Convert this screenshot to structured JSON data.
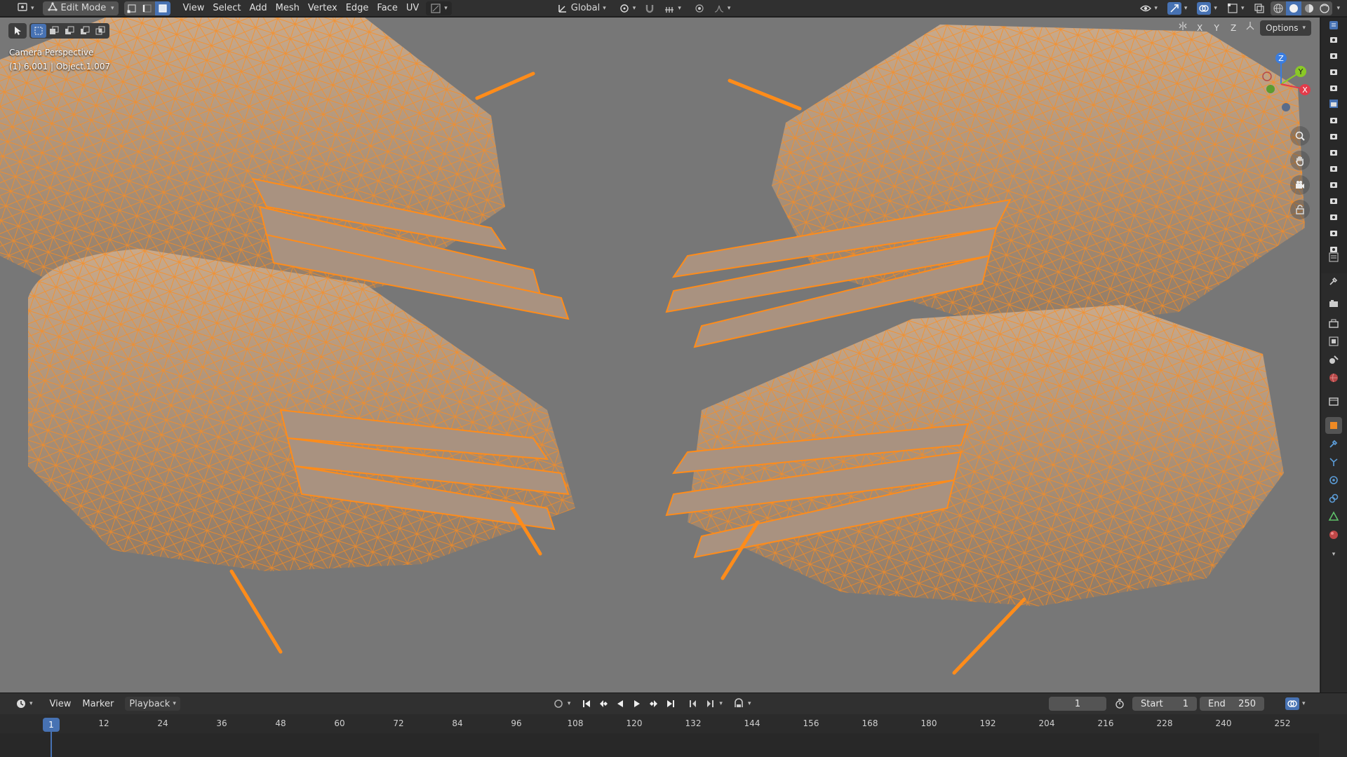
{
  "header": {
    "mode_label": "Edit Mode",
    "menus": [
      "View",
      "Select",
      "Add",
      "Mesh",
      "Vertex",
      "Edge",
      "Face",
      "UV"
    ],
    "orientation_label": "Global",
    "select_modes": [
      "vertex-select",
      "edge-select",
      "face-select"
    ],
    "active_select_mode": "face-select"
  },
  "viewport": {
    "info_line1": "Camera Perspective",
    "info_line2": "(1) 6.001 | Object.1.007",
    "axis_labels": [
      "X",
      "Y",
      "Z"
    ],
    "options_label": "Options",
    "gizmo_axes": {
      "x": "X",
      "y": "Y",
      "z": "Z"
    },
    "background_color": "#777777",
    "wire_color": "#ff8c1a"
  },
  "timeline": {
    "menus": [
      "View",
      "Marker",
      "Playback"
    ],
    "current_frame": "1",
    "start_label": "Start",
    "start_value": "1",
    "end_label": "End",
    "end_value": "250",
    "playhead_frame": "1",
    "ticks": [
      "12",
      "24",
      "36",
      "48",
      "60",
      "72",
      "84",
      "96",
      "108",
      "120",
      "132",
      "144",
      "156",
      "168",
      "180",
      "192",
      "204",
      "216",
      "228",
      "240",
      "252"
    ]
  },
  "colors": {
    "accent": "#4772b3",
    "selection_orange": "#ff8c1a",
    "header_bg": "#303030"
  }
}
